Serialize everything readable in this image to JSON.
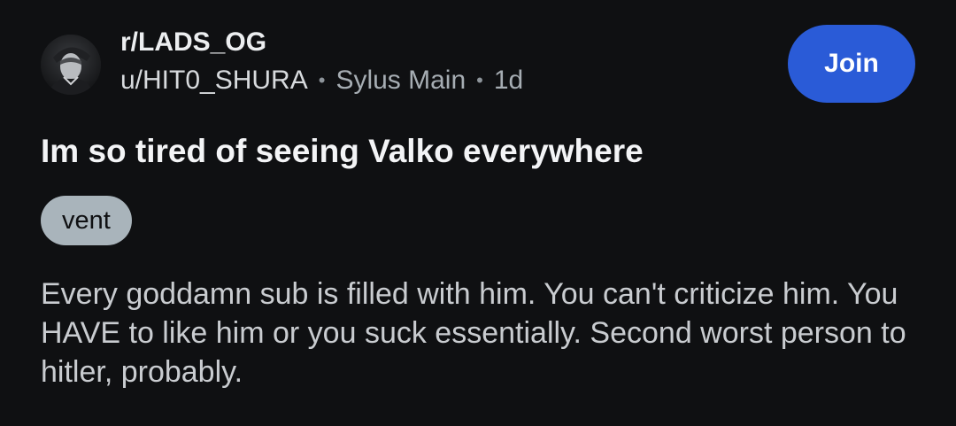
{
  "post": {
    "subreddit": "r/LADS_OG",
    "author": "u/HIT0_SHURA",
    "separator": "•",
    "user_flair": "Sylus Main",
    "age": "1d",
    "join_label": "Join",
    "title": "Im so tired of seeing Valko everywhere",
    "post_flair": "vent",
    "body": "Every goddamn sub is filled with him. You can't criticize him. You HAVE to like him or you suck essentially. Second worst person to hitler, probably."
  },
  "colors": {
    "background": "#0f1012",
    "join_button": "#2a5bd7",
    "flair_chip": "#a9b4bb"
  },
  "icons": {
    "avatar": "user-avatar-photo"
  }
}
